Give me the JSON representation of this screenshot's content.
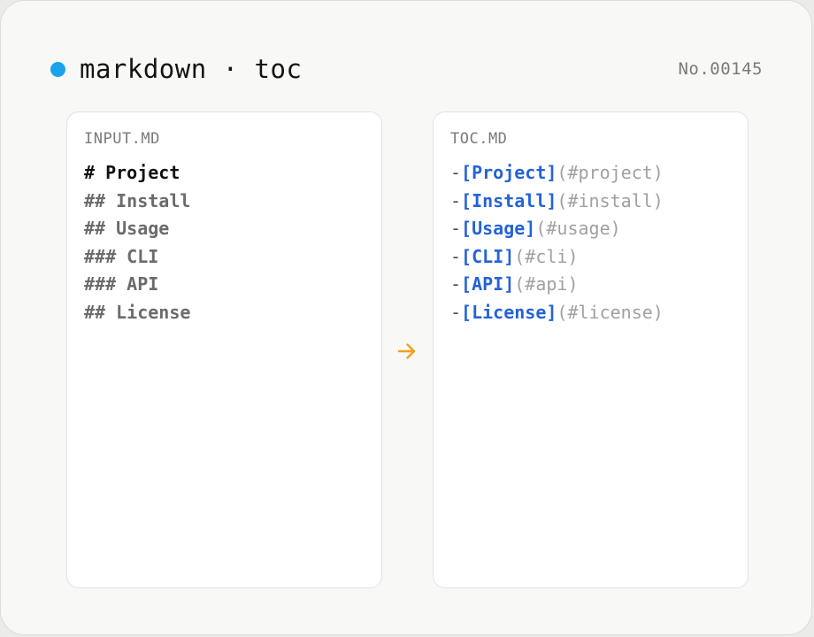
{
  "header": {
    "title": "markdown · toc",
    "serial": "No.00145",
    "dot_color": "#1aa3ec"
  },
  "input_panel": {
    "label": "INPUT.MD",
    "lines": [
      {
        "text": "# Project",
        "level": 1
      },
      {
        "text": "## Install",
        "level": 2
      },
      {
        "text": "## Usage",
        "level": 2
      },
      {
        "text": "### CLI",
        "level": 3
      },
      {
        "text": "### API",
        "level": 3
      },
      {
        "text": "## License",
        "level": 2
      }
    ]
  },
  "arrow": {
    "icon": "arrow-right-icon",
    "color": "#f0a020"
  },
  "output_panel": {
    "label": "TOC.MD",
    "entries": [
      {
        "dash": "-",
        "link": "[Project]",
        "anchor": "(#project)"
      },
      {
        "dash": "-",
        "link": "[Install]",
        "anchor": "(#install)"
      },
      {
        "dash": "-",
        "link": "[Usage]",
        "anchor": "(#usage)"
      },
      {
        "dash": "-",
        "link": "[CLI]",
        "anchor": "(#cli)"
      },
      {
        "dash": "-",
        "link": "[API]",
        "anchor": "(#api)"
      },
      {
        "dash": "-",
        "link": "[License]",
        "anchor": "(#license)"
      }
    ]
  }
}
